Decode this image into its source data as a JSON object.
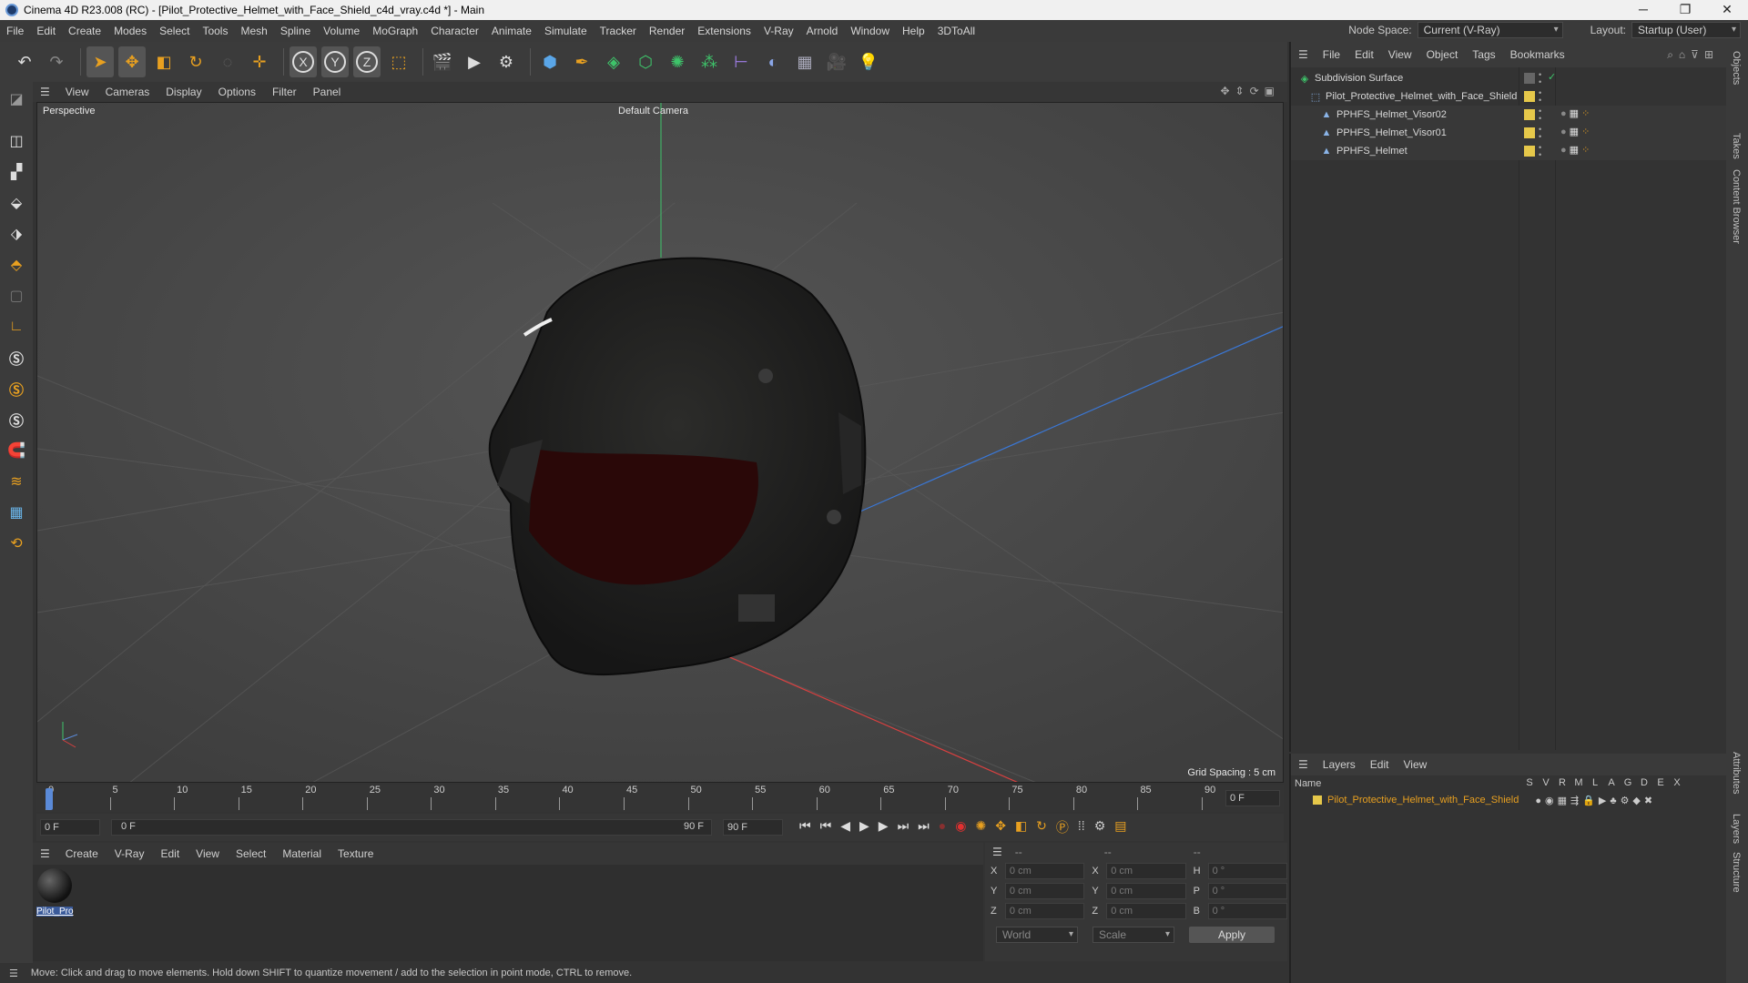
{
  "window": {
    "title": "Cinema 4D R23.008 (RC) - [Pilot_Protective_Helmet_with_Face_Shield_c4d_vray.c4d *] - Main",
    "controls": [
      "─",
      "❐",
      "✕"
    ]
  },
  "menubar": {
    "items": [
      "File",
      "Edit",
      "Create",
      "Modes",
      "Select",
      "Tools",
      "Mesh",
      "Spline",
      "Volume",
      "MoGraph",
      "Character",
      "Animate",
      "Simulate",
      "Tracker",
      "Render",
      "Extensions",
      "V-Ray",
      "Arnold",
      "Window",
      "Help",
      "3DToAll"
    ],
    "node_space_label": "Node Space:",
    "node_space_value": "Current (V-Ray)",
    "layout_label": "Layout:",
    "layout_value": "Startup (User)"
  },
  "viewport": {
    "menu": [
      "View",
      "Cameras",
      "Display",
      "Options",
      "Filter",
      "Panel"
    ],
    "name": "Perspective",
    "camera": "Default Camera",
    "grid_spacing": "Grid Spacing : 5 cm"
  },
  "timeline": {
    "ticks": [
      "0",
      "5",
      "10",
      "15",
      "20",
      "25",
      "30",
      "35",
      "40",
      "45",
      "50",
      "55",
      "60",
      "65",
      "70",
      "75",
      "80",
      "85",
      "90"
    ],
    "current_frame": "0 F",
    "start_field": "0 F",
    "range_start": "0 F",
    "range_end": "90 F",
    "end_field": "90 F"
  },
  "material_manager": {
    "menu": [
      "Create",
      "V-Ray",
      "Edit",
      "View",
      "Select",
      "Material",
      "Texture"
    ],
    "materials": [
      {
        "name": "Pilot_Pro"
      }
    ]
  },
  "coordinates": {
    "header": [
      "--",
      "--",
      "--"
    ],
    "rows": [
      {
        "a": "X",
        "av": "0 cm",
        "b": "X",
        "bv": "0 cm",
        "c": "H",
        "cv": "0 °"
      },
      {
        "a": "Y",
        "av": "0 cm",
        "b": "Y",
        "bv": "0 cm",
        "c": "P",
        "cv": "0 °"
      },
      {
        "a": "Z",
        "av": "0 cm",
        "b": "Z",
        "bv": "0 cm",
        "c": "B",
        "cv": "0 °"
      }
    ],
    "mode": "World",
    "transform": "Scale",
    "apply": "Apply"
  },
  "status": "Move: Click and drag to move elements. Hold down SHIFT to quantize movement / add to the selection in point mode, CTRL to remove.",
  "object_manager": {
    "menu": [
      "File",
      "Edit",
      "View",
      "Object",
      "Tags",
      "Bookmarks"
    ],
    "objects": [
      {
        "name": "Subdivision Surface",
        "indent": 0
      },
      {
        "name": "Pilot_Protective_Helmet_with_Face_Shield",
        "indent": 1
      },
      {
        "name": "PPHFS_Helmet_Visor02",
        "indent": 2
      },
      {
        "name": "PPHFS_Helmet_Visor01",
        "indent": 2
      },
      {
        "name": "PPHFS_Helmet",
        "indent": 2
      }
    ]
  },
  "layer_manager": {
    "menu": [
      "Layers",
      "Edit",
      "View"
    ],
    "name_header": "Name",
    "flags": [
      "S",
      "V",
      "R",
      "M",
      "L",
      "A",
      "G",
      "D",
      "E",
      "X"
    ],
    "layers": [
      {
        "name": "Pilot_Protective_Helmet_with_Face_Shield"
      }
    ]
  },
  "side_tabs": [
    "Objects",
    "Takes",
    "Content Browser",
    "Attributes",
    "Layers",
    "Structure"
  ]
}
